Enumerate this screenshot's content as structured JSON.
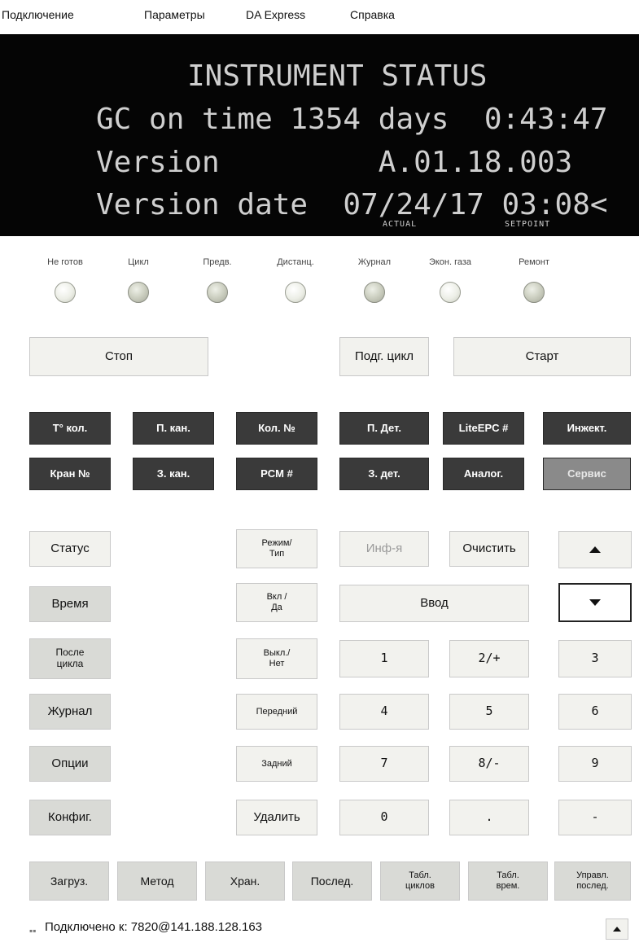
{
  "menu": [
    "Подключение",
    "Параметры",
    "DA Express",
    "Справка"
  ],
  "display": {
    "line1": "INSTRUMENT STATUS",
    "line2": "GC on time 1354 days  0:43:47",
    "line3": "Version         A.01.18.003",
    "line4": "Version date  07/24/17 03:08<",
    "actual_label": "ACTUAL",
    "setpoint_label": "SETPOINT",
    "text_color": "#cfcfcf",
    "background": "#050505"
  },
  "indicators": [
    {
      "label": "Не готов",
      "on": false
    },
    {
      "label": "Цикл",
      "on": true
    },
    {
      "label": "Предв.",
      "on": true
    },
    {
      "label": "Дистанц.",
      "on": false
    },
    {
      "label": "Журнал",
      "on": true
    },
    {
      "label": "Экон. газа",
      "on": false
    },
    {
      "label": "Ремонт",
      "on": true
    }
  ],
  "run": {
    "stop": "Стоп",
    "prep": "Подг. цикл",
    "start": "Старт"
  },
  "function_row1": [
    "Т° кол.",
    "П. кан.",
    "Кол. №",
    "П. Дет.",
    "LiteEPC #",
    "Инжект."
  ],
  "function_row2": [
    "Кран №",
    "З. кан.",
    "PCM #",
    "З. дет.",
    "Аналог.",
    "Сервис"
  ],
  "keys": {
    "status": "Статус",
    "time": "Время",
    "post_run": "После цикла",
    "log": "Журнал",
    "options": "Опции",
    "config": "Конфиг.",
    "mode_type": "Режим/ Тип",
    "on_yes": "Вкл / Да",
    "off_no": "Выкл./ Нет",
    "front": "Передний",
    "back": "Задний",
    "delete": "Удалить",
    "info": "Инф-я",
    "clear": "Очистить",
    "enter": "Ввод",
    "k1": "1",
    "k2": "2/+",
    "k3": "3",
    "k4": "4",
    "k5": "5",
    "k6": "6",
    "k7": "7",
    "k8": "8/-",
    "k9": "9",
    "k0": "0",
    "kdot": ".",
    "kminus": "-"
  },
  "bottom": [
    "Загруз.",
    "Метод",
    "Хран.",
    "Послед.",
    "Табл. циклов",
    "Табл. врем.",
    "Управл. послед."
  ],
  "status": {
    "connected": "Подключено к: 7820@141.188.128.163"
  },
  "colors": {
    "dark_key": "#3a3a3a",
    "service_key": "#8a8a8a",
    "light_key": "#f2f2ee",
    "shaded_key": "#d9dad6"
  }
}
